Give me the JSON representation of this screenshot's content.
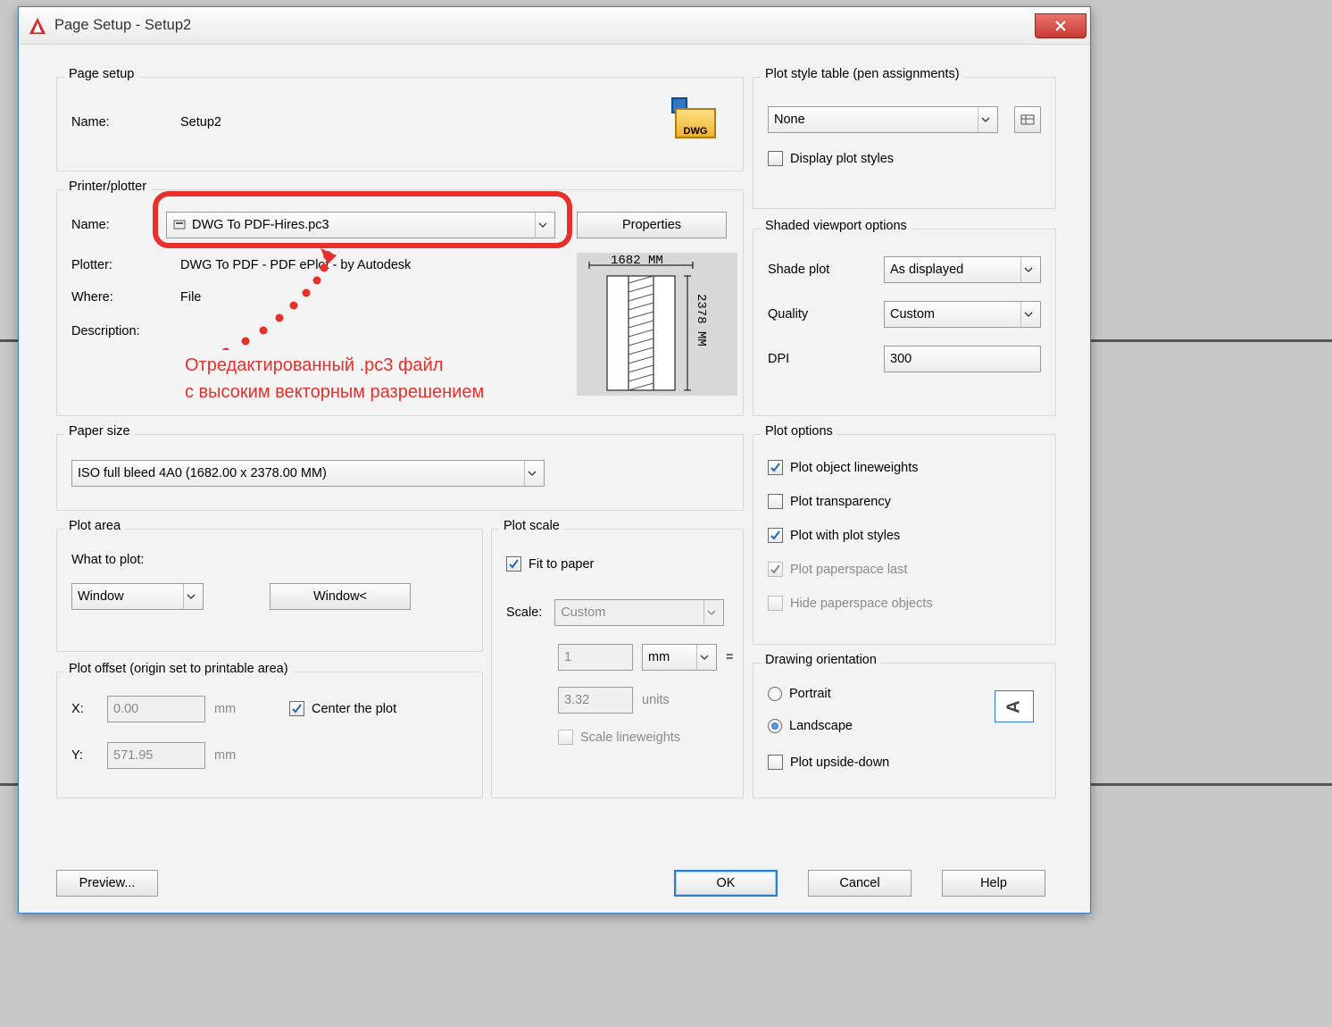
{
  "window": {
    "title": "Page Setup - Setup2"
  },
  "pageSetup": {
    "legend": "Page setup",
    "nameLabel": "Name:",
    "name": "Setup2",
    "dwgBadge": "DWG"
  },
  "printer": {
    "legend": "Printer/plotter",
    "nameLabel": "Name:",
    "nameValue": "DWG To PDF-Hires.pc3",
    "propertiesBtn": "Properties",
    "plotterLabel": "Plotter:",
    "plotterValue": "DWG To PDF - PDF ePlot - by Autodesk",
    "whereLabel": "Where:",
    "whereValue": "File",
    "descriptionLabel": "Description:",
    "preview": {
      "w": "1682 MM",
      "h": "2378 MM"
    }
  },
  "paperSize": {
    "legend": "Paper size",
    "value": "ISO full bleed 4A0 (1682.00 x 2378.00 MM)"
  },
  "plotArea": {
    "legend": "Plot area",
    "whatLabel": "What to plot:",
    "whatValue": "Window",
    "windowBtn": "Window<"
  },
  "plotOffset": {
    "legend": "Plot offset (origin set to printable area)",
    "xLabel": "X:",
    "xValue": "0.00",
    "yLabel": "Y:",
    "yValue": "571.95",
    "unit": "mm",
    "centerLabel": "Center the plot"
  },
  "plotScale": {
    "legend": "Plot scale",
    "fitLabel": "Fit to paper",
    "scaleLabel": "Scale:",
    "scaleValue": "Custom",
    "num": "1",
    "unit": "mm",
    "eq": "=",
    "denom": "3.32",
    "denomUnit": "units",
    "scaleLwLabel": "Scale lineweights"
  },
  "plotStyle": {
    "legend": "Plot style table (pen assignments)",
    "value": "None",
    "displayLabel": "Display plot styles"
  },
  "shaded": {
    "legend": "Shaded viewport options",
    "shadeLabel": "Shade plot",
    "shadeValue": "As displayed",
    "qualityLabel": "Quality",
    "qualityValue": "Custom",
    "dpiLabel": "DPI",
    "dpiValue": "300"
  },
  "plotOptions": {
    "legend": "Plot options",
    "lineweights": "Plot object lineweights",
    "transparency": "Plot transparency",
    "withStyles": "Plot with plot styles",
    "paperspaceLast": "Plot paperspace last",
    "hidePaperspace": "Hide paperspace objects"
  },
  "orientation": {
    "legend": "Drawing orientation",
    "portrait": "Portrait",
    "landscape": "Landscape",
    "upsideDown": "Plot upside-down",
    "glyph": "A"
  },
  "buttons": {
    "preview": "Preview...",
    "ok": "OK",
    "cancel": "Cancel",
    "help": "Help"
  },
  "annotation": {
    "line1": "Отредактированный .pc3 файл",
    "line2": "с высоким векторным разрешением"
  }
}
